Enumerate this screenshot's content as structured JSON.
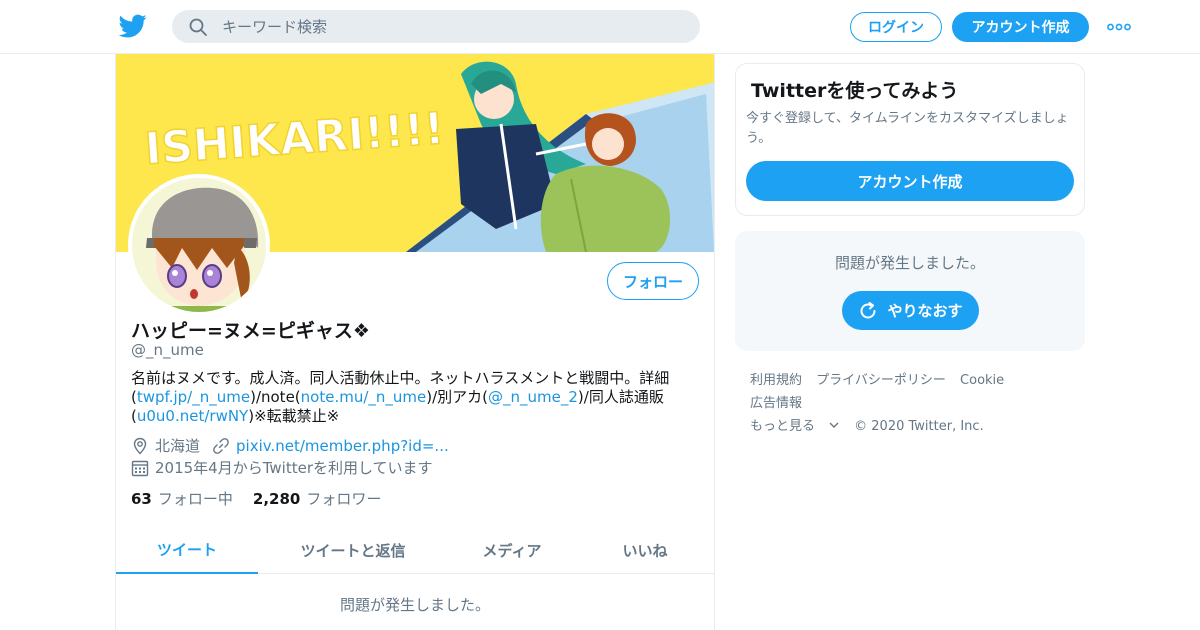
{
  "header": {
    "search_placeholder": "キーワード検索",
    "login_label": "ログイン",
    "signup_label": "アカウント作成"
  },
  "profile": {
    "banner_text": "ISHIKARI!!!!",
    "follow_label": "フォロー",
    "name": "ハッピー=ヌメ=ピギャス❖",
    "handle": "@_n_ume",
    "bio": {
      "t1": "名前はヌメです。成人済。同人活動休止中。ネットハラスメントと戦闘中。詳細(",
      "l1": "twpf.jp/_n_ume",
      "t2": ")/note(",
      "l2": "note.mu/_n_ume",
      "t3": ")/別アカ(",
      "l3": "@_n_ume_2",
      "t4": ")/同人誌通販(",
      "l4": "u0u0.net/rwNY",
      "t5": ")※転載禁止※"
    },
    "location": "北海道",
    "website": "pixiv.net/member.php?id=...",
    "joined": "2015年4月からTwitterを利用しています",
    "following_count": "63",
    "following_label": "フォロー中",
    "followers_count": "2,280",
    "followers_label": "フォロワー"
  },
  "tabs": [
    {
      "label": "ツイート",
      "active": true
    },
    {
      "label": "ツイートと返信",
      "active": false
    },
    {
      "label": "メディア",
      "active": false
    },
    {
      "label": "いいね",
      "active": false
    }
  ],
  "timeline_error": "問題が発生しました。",
  "sidebar": {
    "signup_card": {
      "title": "Twitterを使ってみよう",
      "text": "今すぐ登録して、タイムラインをカスタマイズしましょう。",
      "button": "アカウント作成"
    },
    "error_card": {
      "text": "問題が発生しました。",
      "retry_label": "やりなおす"
    }
  },
  "footer": {
    "terms": "利用規約",
    "privacy": "プライバシーポリシー",
    "cookie": "Cookie",
    "ads": "広告情報",
    "more": "もっと見る",
    "copyright": "© 2020 Twitter, Inc."
  },
  "colors": {
    "accent": "#1da1f2",
    "link": "#1b95e0",
    "secondary_text": "#657786",
    "banner_bg": "#fde74c"
  }
}
